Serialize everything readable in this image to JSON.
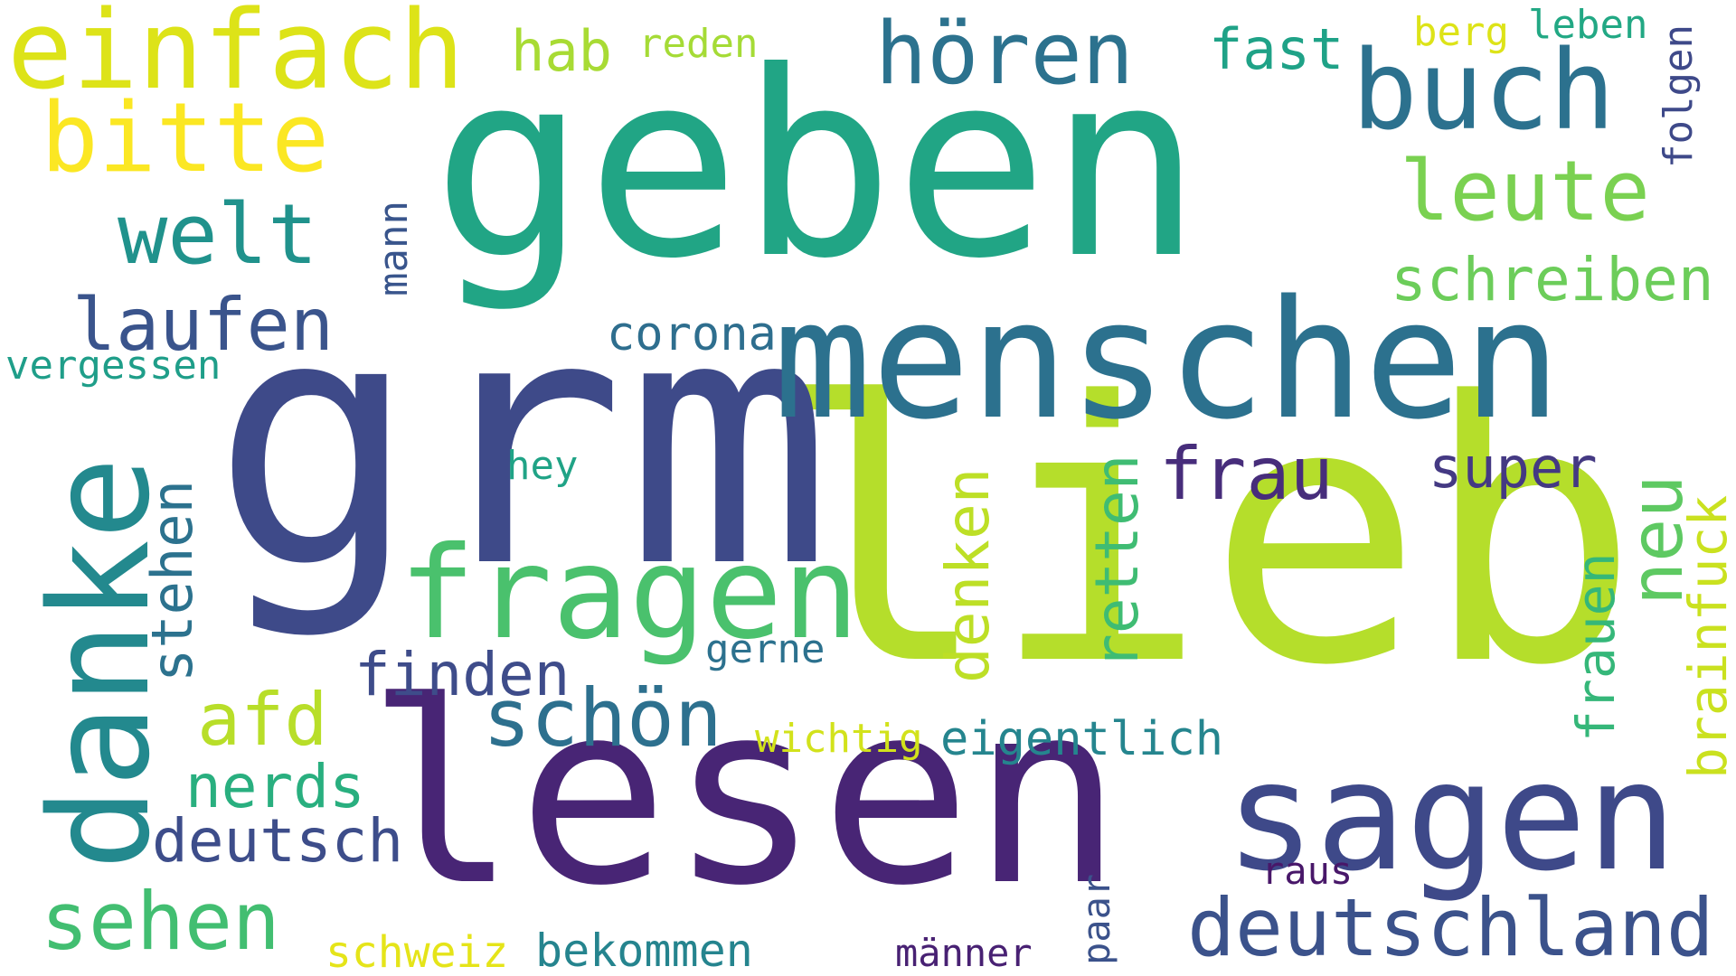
{
  "palette": {
    "dark_purple": "#472374",
    "indigo": "#3e4a89",
    "blue": "#31678e",
    "teal": "#26828e",
    "green_teal": "#1f9e89",
    "green": "#35b779",
    "light_green": "#6ece58",
    "lime": "#b5de2b",
    "yellow": "#fde725"
  },
  "words": [
    {
      "text": "lieb",
      "color": "#b5de2b"
    },
    {
      "text": "grm",
      "color": "#3e4a89"
    },
    {
      "text": "geben",
      "color": "#21a585"
    },
    {
      "text": "lesen",
      "color": "#482575"
    },
    {
      "text": "menschen",
      "color": "#2c718e"
    },
    {
      "text": "danke",
      "color": "#23898e"
    },
    {
      "text": "sagen",
      "color": "#3e4989"
    },
    {
      "text": "fragen",
      "color": "#4ac16d"
    },
    {
      "text": "einfach",
      "color": "#dde318"
    },
    {
      "text": "buch",
      "color": "#2c718e"
    },
    {
      "text": "bitte",
      "color": "#fbe723"
    },
    {
      "text": "hören",
      "color": "#2c728e"
    },
    {
      "text": "welt",
      "color": "#20928c"
    },
    {
      "text": "leute",
      "color": "#7ad151"
    },
    {
      "text": "deutschland",
      "color": "#3b528b"
    },
    {
      "text": "schön",
      "color": "#2d708e"
    },
    {
      "text": "sehen",
      "color": "#42be71"
    },
    {
      "text": "frau",
      "color": "#472d7b"
    },
    {
      "text": "laufen",
      "color": "#3a548c"
    },
    {
      "text": "schreiben",
      "color": "#6ccd5a"
    },
    {
      "text": "afd",
      "color": "#b8de29"
    },
    {
      "text": "neu",
      "color": "#5ec962"
    },
    {
      "text": "denken",
      "color": "#bddf26"
    },
    {
      "text": "nerds",
      "color": "#29af7f"
    },
    {
      "text": "finden",
      "color": "#3e4c8a"
    },
    {
      "text": "deutsch",
      "color": "#3d4d8a"
    },
    {
      "text": "retten",
      "color": "#3fbc73"
    },
    {
      "text": "stehen",
      "color": "#2c728e"
    },
    {
      "text": "super",
      "color": "#443983"
    },
    {
      "text": "brainfuck",
      "color": "#cae11f"
    },
    {
      "text": "frauen",
      "color": "#35b779"
    },
    {
      "text": "fast",
      "color": "#1fa287"
    },
    {
      "text": "hab",
      "color": "#a8db34"
    },
    {
      "text": "eigentlich",
      "color": "#25858e"
    },
    {
      "text": "corona",
      "color": "#2e6e8e"
    },
    {
      "text": "bekommen",
      "color": "#25848e"
    },
    {
      "text": "vergessen",
      "color": "#1f9e89"
    },
    {
      "text": "schweiz",
      "color": "#e5e419"
    },
    {
      "text": "mann",
      "color": "#39558c"
    },
    {
      "text": "folgen",
      "color": "#3e4989"
    },
    {
      "text": "berg",
      "color": "#dde318"
    },
    {
      "text": "leben",
      "color": "#22a884"
    },
    {
      "text": "reden",
      "color": "#a5db36"
    },
    {
      "text": "hey",
      "color": "#20a386"
    },
    {
      "text": "gerne",
      "color": "#2c718e"
    },
    {
      "text": "wichtig",
      "color": "#d2e21b"
    },
    {
      "text": "raus",
      "color": "#481769"
    },
    {
      "text": "paar",
      "color": "#3b528b"
    },
    {
      "text": "männer",
      "color": "#482173"
    }
  ]
}
